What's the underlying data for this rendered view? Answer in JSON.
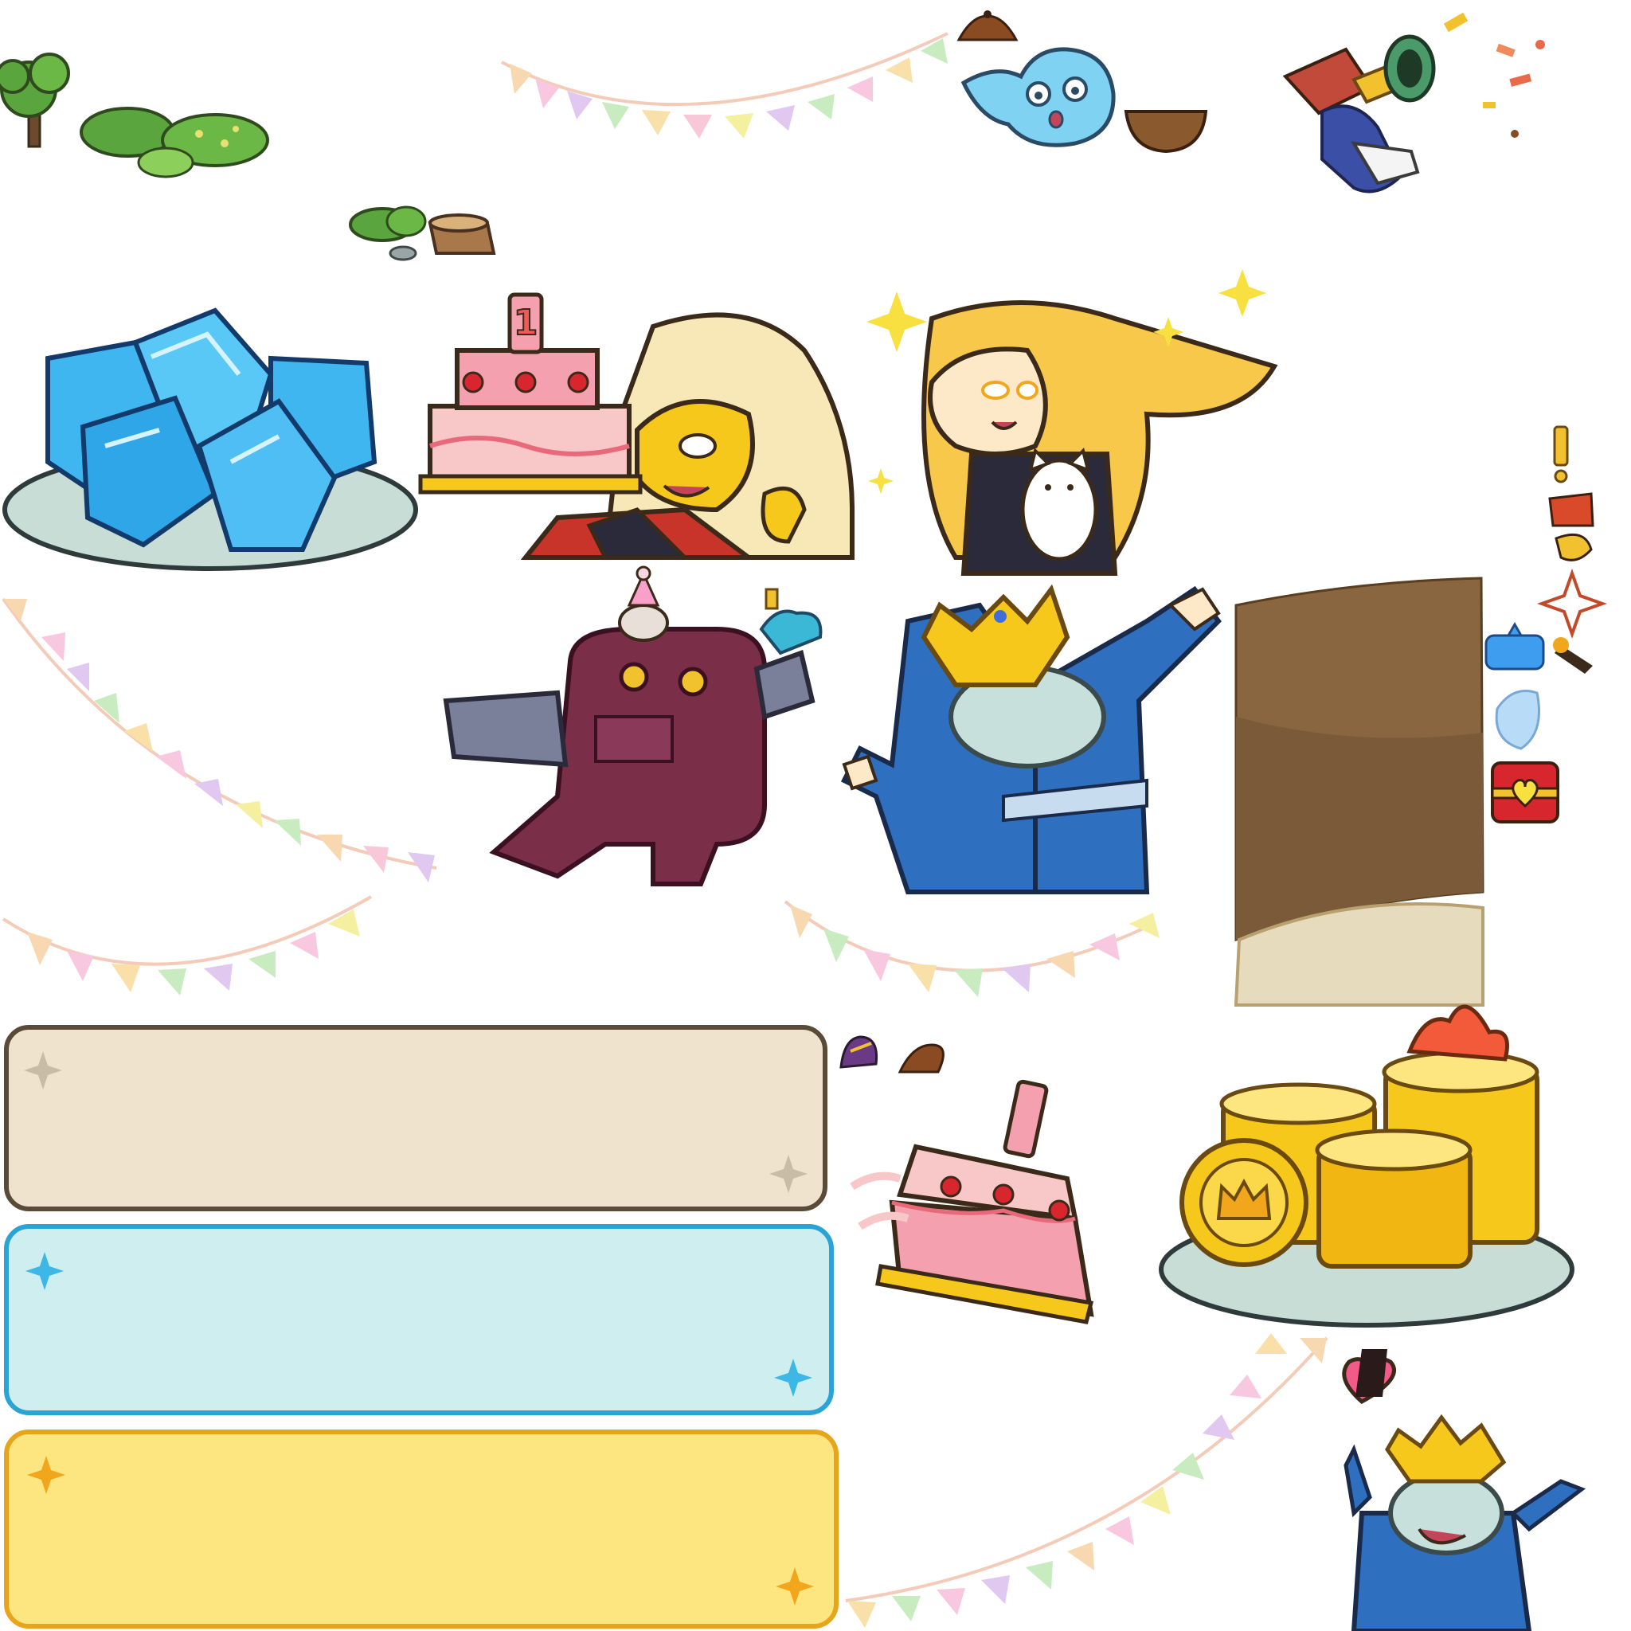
{
  "atlas": {
    "kind": "game sprite sheet",
    "background": "#ffffff"
  },
  "cake_candle_digit": "1",
  "palette": {
    "bunting": [
      "#f8c8e0",
      "#f8d8b0",
      "#c8ecc0",
      "#f8e0a8",
      "#e0c8f0",
      "#f4f0a0",
      "#f8d0d8"
    ],
    "gem_blue": "#3fb6f0",
    "gold": "#f7c81c",
    "cake_pink": "#f5a0ae",
    "robe_blue": "#2f6fbf",
    "robot_maroon": "#7a2e48",
    "panel_beige": "#efe3ce",
    "panel_cyan": "#cfeef0",
    "panel_yellow": "#fde680",
    "plate": "#c7ddd6"
  },
  "panels": [
    {
      "theme": "beige",
      "fill": "#efe3ce",
      "border": "#5a4a38",
      "star": "#c9bca6"
    },
    {
      "theme": "cyan",
      "fill": "#cfeef0",
      "border": "#2aa3d6",
      "star": "#3cb7e6"
    },
    {
      "theme": "yellow",
      "fill": "#fde680",
      "border": "#e7a51c",
      "star": "#f2a61c"
    }
  ],
  "icons": [
    "bush-icon",
    "tree-icon",
    "stump-icon",
    "bell-icon",
    "ghost-spirit-icon",
    "wizard-trumpet-icon",
    "gem-plate-icon",
    "birthday-cake-icon",
    "sun-heroine-cake-icon",
    "blonde-heroine-cat-icon",
    "mouse-robot-icon",
    "king-dab-icon",
    "dirt-panel-icon",
    "exclamation-icon",
    "speech-bubble-icon",
    "heart-chest-icon",
    "flying-cake-icon",
    "gold-coin-plate-icon",
    "king-heart-icon"
  ]
}
